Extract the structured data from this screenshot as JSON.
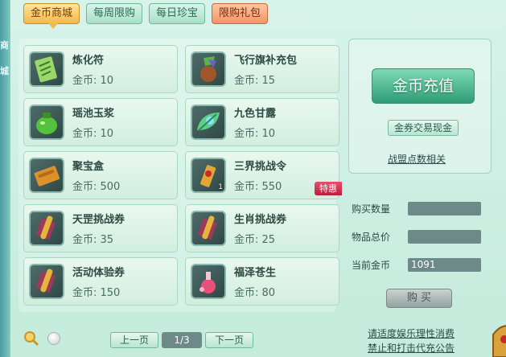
{
  "edge_glyphs": [
    "商",
    "城"
  ],
  "tabs": [
    {
      "label": "金币商城",
      "active": true
    },
    {
      "label": "每周限购",
      "active": false
    },
    {
      "label": "每日珍宝",
      "active": false
    },
    {
      "label": "限购礼包",
      "active": false
    }
  ],
  "items": [
    {
      "name": "炼化符",
      "price": "金币: 10",
      "icon": "talisman-icon"
    },
    {
      "name": "飞行旗补充包",
      "price": "金币: 15",
      "icon": "flag-pouch-icon"
    },
    {
      "name": "瑶池玉浆",
      "price": "金币: 10",
      "icon": "green-jar-icon"
    },
    {
      "name": "九色甘露",
      "price": "金币: 10",
      "icon": "dew-leaf-icon"
    },
    {
      "name": "聚宝盒",
      "price": "金币: 500",
      "icon": "treasure-box-icon"
    },
    {
      "name": "三界挑战令",
      "price": "金币: 550",
      "icon": "challenge-token-icon",
      "count": "1",
      "badge": "特惠"
    },
    {
      "name": "天罡挑战券",
      "price": "金币: 35",
      "icon": "scroll-icon"
    },
    {
      "name": "生肖挑战券",
      "price": "金币: 25",
      "icon": "scroll-icon"
    },
    {
      "name": "活动体验券",
      "price": "金币: 150",
      "icon": "scroll-icon"
    },
    {
      "name": "福泽苍生",
      "price": "金币: 80",
      "icon": "potion-icon"
    }
  ],
  "panel": {
    "recharge_label": "金币充值",
    "trade_label": "金券交易现金",
    "points_label": "战盟点数相关"
  },
  "form": {
    "qty_label": "购买数量",
    "qty_value": "",
    "total_label": "物品总价",
    "total_value": "",
    "gold_label": "当前金币",
    "gold_value": "1091",
    "buy_label": "购 买"
  },
  "pager": {
    "prev": "上一页",
    "page": "1/3",
    "next": "下一页"
  },
  "notice": {
    "line1": "请适度娱乐理性消费",
    "line2": "禁止和打击代充公告"
  }
}
